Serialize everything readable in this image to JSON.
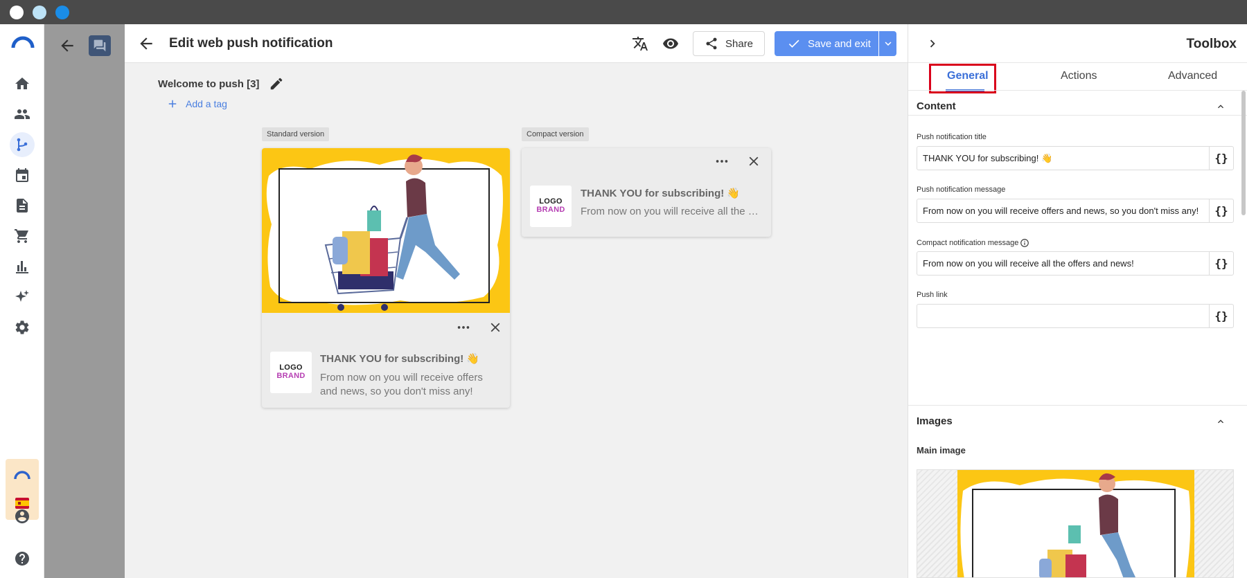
{
  "window": {
    "traffic_lights": [
      "#ffffff",
      "#bde3f7",
      "#1a8de8"
    ]
  },
  "nav": {
    "items": [
      "home-icon",
      "people-icon",
      "flow-icon",
      "calendar-icon",
      "document-icon",
      "cart-icon",
      "chart-icon",
      "sparkle-icon",
      "settings-icon"
    ],
    "bottom": [
      "account-icon",
      "help-icon"
    ],
    "active_color": "#3a6fd8"
  },
  "editor": {
    "title": "Edit web push notification",
    "share_label": "Share",
    "save_label": "Save and exit",
    "notification_name": "Welcome to push [3]",
    "add_tag_label": "Add a tag",
    "standard_label": "Standard version",
    "compact_label": "Compact version",
    "logo_line1": "LOGO",
    "logo_line2": "BRAND",
    "standard": {
      "title": "THANK YOU for subscribing! 👋",
      "message": "From now on you will receive offers and news, so you don't miss any!"
    },
    "compact": {
      "title": "THANK YOU for subscribing! 👋",
      "message": "From now on you will receive all the …"
    },
    "accent_color": "#5b8ff0"
  },
  "toolbox": {
    "title": "Toolbox",
    "tabs": [
      "General",
      "Actions",
      "Advanced"
    ],
    "active_tab": "General",
    "content_section": "Content",
    "fields": [
      {
        "label": "Push notification title",
        "value": "THANK YOU for subscribing! 👋"
      },
      {
        "label": "Push notification message",
        "value": "From now on you will receive offers and news, so you don't miss any!"
      },
      {
        "label": "Compact notification message",
        "value": "From now on you will receive all the offers and news!"
      },
      {
        "label": "Push link",
        "value": ""
      }
    ],
    "braces": "{}",
    "images_section": "Images",
    "main_image_label": "Main image"
  }
}
